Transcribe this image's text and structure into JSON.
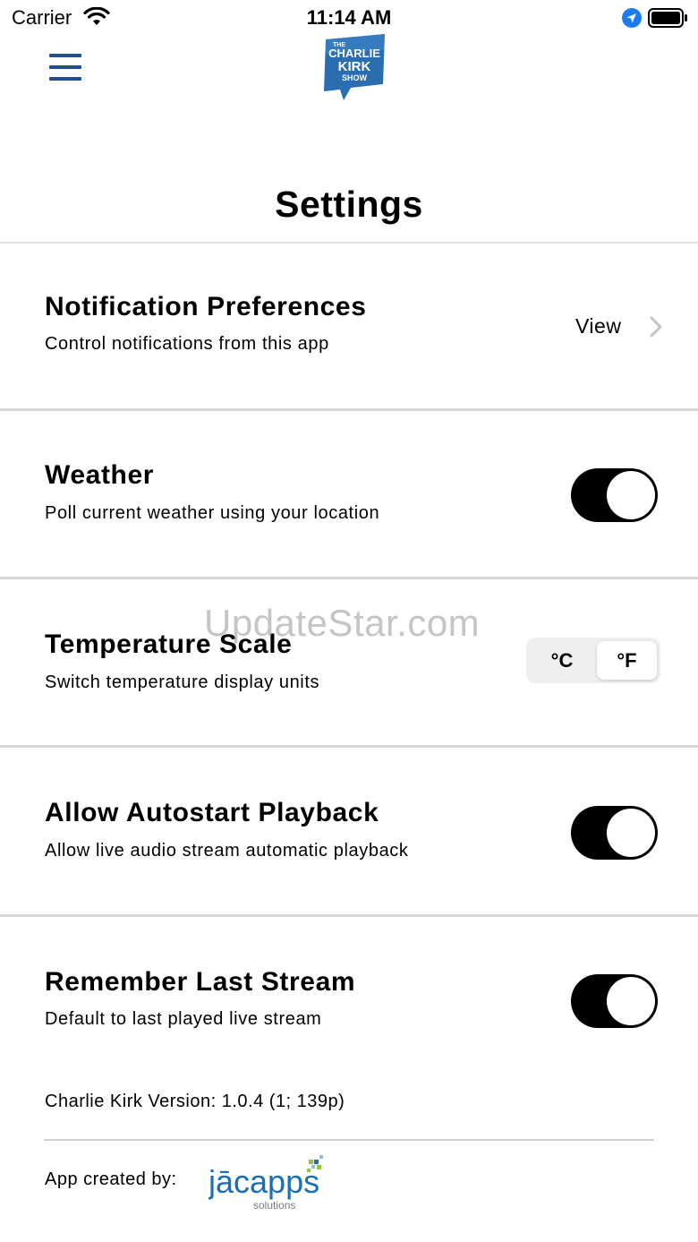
{
  "status_bar": {
    "carrier": "Carrier",
    "time": "11:14 AM"
  },
  "header": {
    "logo_lines": [
      "THE",
      "CHARLIE",
      "KIRK",
      "SHOW"
    ]
  },
  "page": {
    "title": "Settings"
  },
  "settings": [
    {
      "title": "Notification Preferences",
      "subtitle": "Control notifications from this app",
      "action_label": "View"
    },
    {
      "title": "Weather",
      "subtitle": "Poll current weather using your location",
      "enabled": true
    },
    {
      "title": "Temperature Scale",
      "subtitle": "Switch temperature display units",
      "options": [
        "°C",
        "°F"
      ],
      "selected": "°F"
    },
    {
      "title": "Allow Autostart Playback",
      "subtitle": "Allow live audio stream automatic playback",
      "enabled": true
    },
    {
      "title": "Remember Last Stream",
      "subtitle": "Default to last played live stream",
      "enabled": true
    }
  ],
  "footer": {
    "version": "Charlie Kirk Version: 1.0.4 (1; 139p)",
    "created_by_label": "App created by:",
    "creator_logo": {
      "name": "jācapps",
      "tagline": "solutions"
    }
  },
  "watermark": "UpdateStar.com",
  "colors": {
    "accent": "#1f4f8f",
    "toggle_on": "#000000",
    "logo_blue": "#2a6db0",
    "jac_blue": "#1b6fb5",
    "jac_green": "#8dc63f"
  }
}
